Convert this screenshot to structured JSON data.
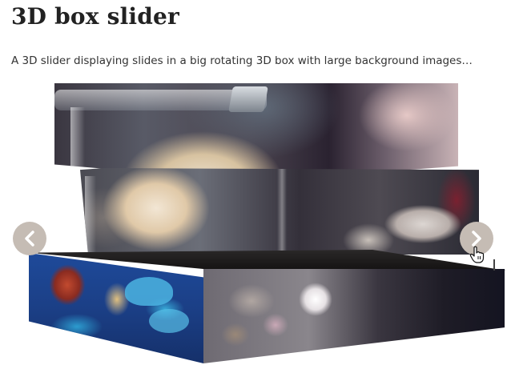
{
  "page": {
    "title": "3D box slider",
    "description": "A 3D slider displaying slides in a big rotating 3D box with large background images…"
  },
  "slider": {
    "prev_icon": "chevron-left-icon",
    "next_icon": "chevron-right-icon",
    "colors": {
      "nav_button_bg": "#c5bcb4",
      "nav_button_fg": "#ffffff"
    }
  },
  "pointer": {
    "icon": "hand-pointer-icon"
  }
}
